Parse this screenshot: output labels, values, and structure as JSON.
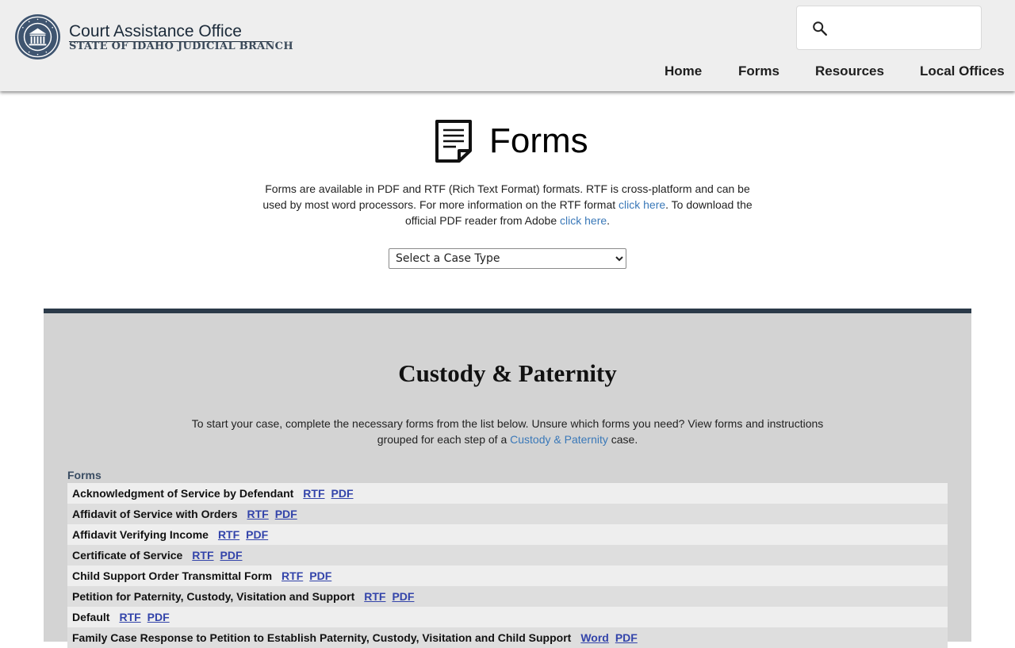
{
  "header": {
    "brand_title": "Court Assistance Office",
    "brand_subtitle": "STATE OF IDAHO JUDICIAL BRANCH",
    "search_placeholder": "",
    "nav": [
      "Home",
      "Forms",
      "Resources",
      "Local Offices"
    ]
  },
  "hero": {
    "title": "Forms",
    "intro_part1": "Forms are available in PDF and RTF (Rich Text Format) formats. RTF is cross-platform and can be used by most word processors. For more information on the RTF format ",
    "intro_link1": "click here",
    "intro_part2": ". To download the official PDF reader from Adobe ",
    "intro_link2": "click here",
    "intro_part3": ".",
    "select_value": "Select a Case Type"
  },
  "section": {
    "title": "Custody & Paternity",
    "desc_part1": "To start your case, complete the necessary forms from the list below. Unsure which forms you need? View forms and instructions grouped for each step of a ",
    "desc_link": "Custody & Paternity",
    "desc_part2": " case.",
    "forms_label": "Forms",
    "forms": [
      {
        "name": "Acknowledgment of Service by Defendant",
        "links": [
          "RTF",
          "PDF"
        ]
      },
      {
        "name": "Affidavit of Service with Orders",
        "links": [
          "RTF",
          "PDF"
        ]
      },
      {
        "name": "Affidavit Verifying Income",
        "links": [
          "RTF",
          "PDF"
        ]
      },
      {
        "name": "Certificate of Service",
        "links": [
          "RTF",
          "PDF"
        ]
      },
      {
        "name": "Child Support Order Transmittal Form",
        "links": [
          "RTF",
          "PDF"
        ]
      },
      {
        "name": "Petition for Paternity, Custody, Visitation and Support",
        "links": [
          "RTF",
          "PDF"
        ]
      },
      {
        "name": "Default",
        "links": [
          "RTF",
          "PDF"
        ]
      },
      {
        "name": "Family Case Response to Petition to Establish Paternity, Custody, Visitation and Child Support",
        "links": [
          "Word",
          "PDF"
        ]
      }
    ]
  },
  "colors": {
    "header_bg": "#eeeeee",
    "panel_bg": "#d3d3d3",
    "panel_border": "#2b3a49",
    "link": "#3a78b8",
    "form_link": "#3344aa"
  },
  "icons": [
    "court-seal-icon",
    "search-icon",
    "document-icon",
    "chevron-down-icon"
  ]
}
